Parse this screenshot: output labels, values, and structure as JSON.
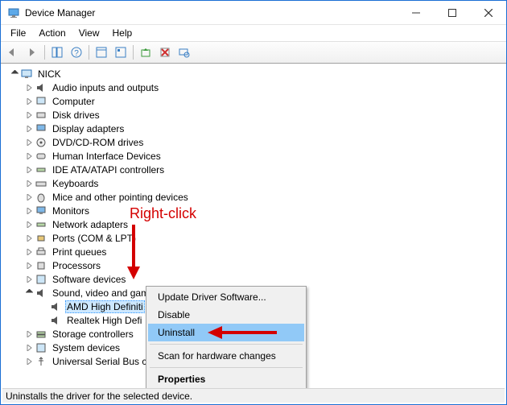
{
  "window": {
    "title": "Device Manager"
  },
  "menu": {
    "file": "File",
    "action": "Action",
    "view": "View",
    "help": "Help"
  },
  "tree": {
    "root": "NICK",
    "items": {
      "n0": "Audio inputs and outputs",
      "n1": "Computer",
      "n2": "Disk drives",
      "n3": "Display adapters",
      "n4": "DVD/CD-ROM drives",
      "n5": "Human Interface Devices",
      "n6": "IDE ATA/ATAPI controllers",
      "n7": "Keyboards",
      "n8": "Mice and other pointing devices",
      "n9": "Monitors",
      "n10": "Network adapters",
      "n11": "Ports (COM & LPT)",
      "n12": "Print queues",
      "n13": "Processors",
      "n14": "Software devices",
      "n15": "Sound, video and game controllers",
      "n15a": "AMD High Definiti",
      "n15b": "Realtek High Defi",
      "n16": "Storage controllers",
      "n17": "System devices",
      "n18": "Universal Serial Bus co"
    }
  },
  "context_menu": {
    "update": "Update Driver Software...",
    "disable": "Disable",
    "uninstall": "Uninstall",
    "scan": "Scan for hardware changes",
    "properties": "Properties"
  },
  "statusbar": {
    "text": "Uninstalls the driver for the selected device."
  },
  "annotation": {
    "label": "Right-click"
  }
}
